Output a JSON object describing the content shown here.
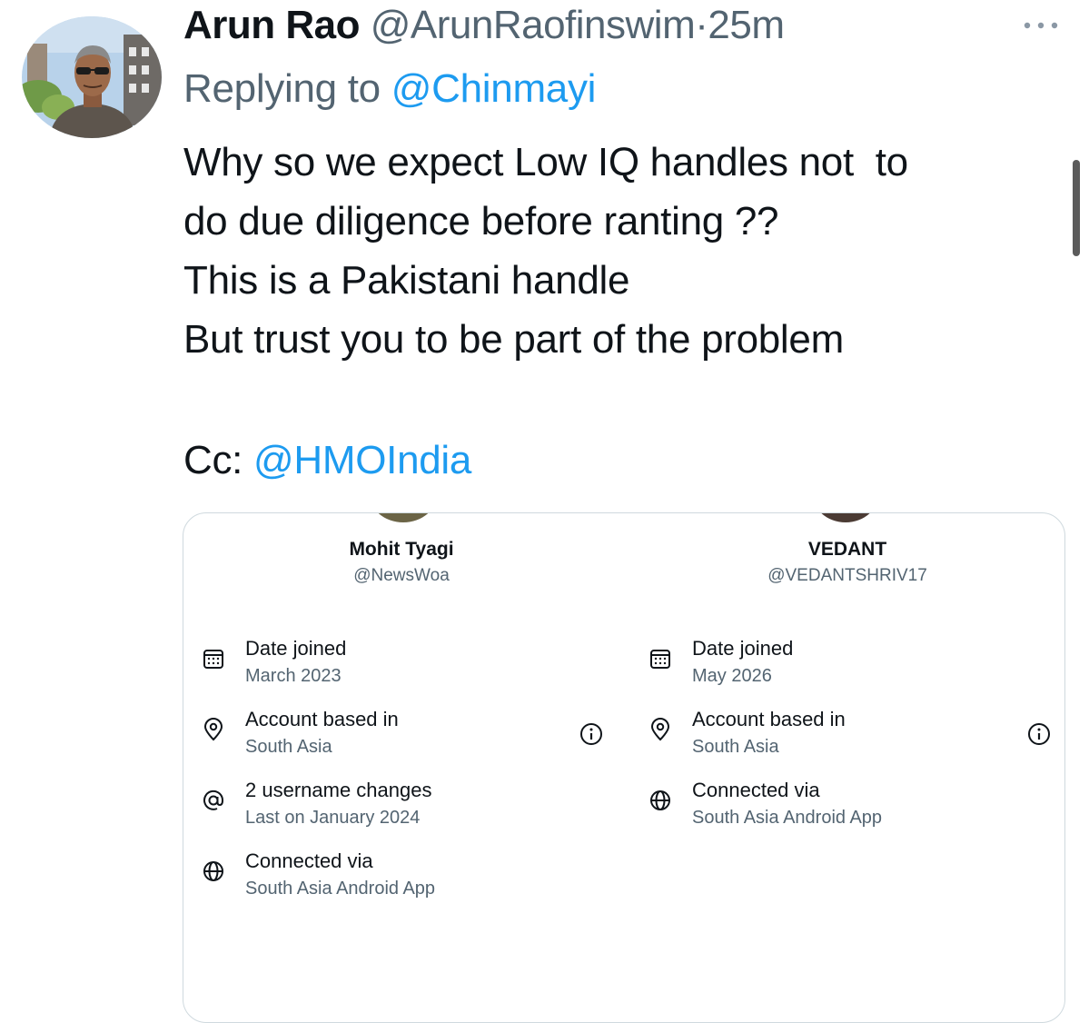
{
  "tweet": {
    "author_name": "Arun Rao",
    "author_handle": "@ArunRaofinswim",
    "separator": "·",
    "time": "25m",
    "replying_prefix": "Replying to",
    "replying_to": "@Chinmayi",
    "body_lines": [
      "Why so we expect Low IQ handles not  to",
      "do due diligence before ranting ??",
      "This is a Pakistani handle",
      "But trust you to be part of the problem"
    ],
    "cc_prefix": "Cc:",
    "cc_mention": "@HMOIndia",
    "more_icon": "more-horizontal-icon",
    "accent_color": "#1d9bf0"
  },
  "card": {
    "left": {
      "name": "Mohit Tyagi",
      "handle": "@NewsWoa",
      "rows": [
        {
          "icon": "calendar-icon",
          "label": "Date joined",
          "value": "March 2023"
        },
        {
          "icon": "location-pin-icon",
          "label": "Account based in",
          "value": "South Asia"
        },
        {
          "icon": "at-sign-icon",
          "label": "2 username changes",
          "value": "Last on January 2024"
        },
        {
          "icon": "globe-icon",
          "label": "Connected via",
          "value": "South Asia Android App"
        }
      ]
    },
    "right": {
      "name": "VEDANT",
      "handle": "@VEDANTSHRIV17",
      "rows": [
        {
          "icon": "calendar-icon",
          "label": "Date joined",
          "value": "May 2026"
        },
        {
          "icon": "location-pin-icon",
          "label": "Account based in",
          "value": "South Asia"
        },
        {
          "icon": "globe-icon",
          "label": "Connected via",
          "value": "South Asia Android App"
        }
      ]
    }
  }
}
